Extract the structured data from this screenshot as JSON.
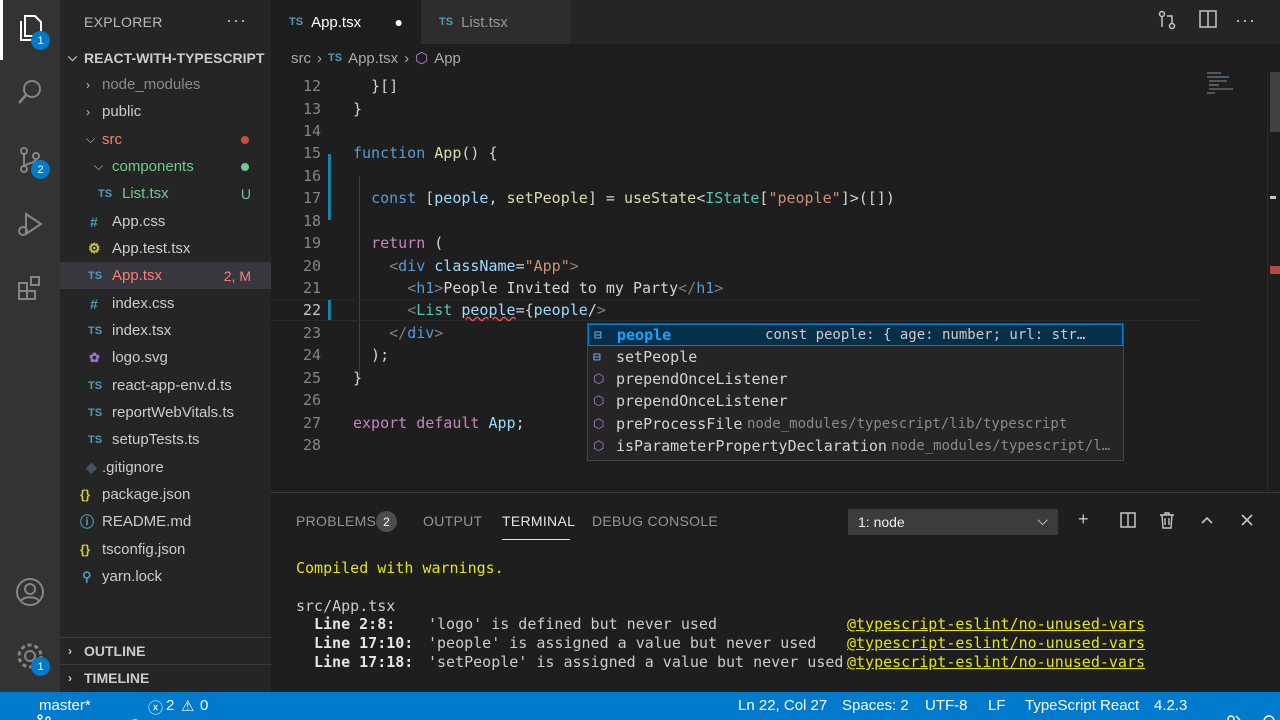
{
  "activity_bar": {
    "explorer_badge": "1",
    "scm_badge": "2",
    "settings_badge": "1"
  },
  "sidebar": {
    "title": "EXPLORER",
    "more": "···",
    "project": "REACT-WITH-TYPESCRIPT",
    "items": [
      {
        "label": "node_modules",
        "kind": "folder"
      },
      {
        "label": "public",
        "kind": "folder"
      },
      {
        "label": "src",
        "kind": "folder"
      },
      {
        "label": "components",
        "kind": "folder"
      },
      {
        "label": "List.tsx",
        "kind": "ts",
        "deco": "U"
      },
      {
        "label": "App.css",
        "kind": "css"
      },
      {
        "label": "App.test.tsx",
        "kind": "test"
      },
      {
        "label": "App.tsx",
        "kind": "ts",
        "deco": "2, M"
      },
      {
        "label": "index.css",
        "kind": "css"
      },
      {
        "label": "index.tsx",
        "kind": "ts"
      },
      {
        "label": "logo.svg",
        "kind": "svg"
      },
      {
        "label": "react-app-env.d.ts",
        "kind": "ts"
      },
      {
        "label": "reportWebVitals.ts",
        "kind": "ts"
      },
      {
        "label": "setupTests.ts",
        "kind": "ts"
      },
      {
        "label": ".gitignore",
        "kind": "git"
      },
      {
        "label": "package.json",
        "kind": "json"
      },
      {
        "label": "README.md",
        "kind": "info"
      },
      {
        "label": "tsconfig.json",
        "kind": "json"
      },
      {
        "label": "yarn.lock",
        "kind": "lock"
      }
    ],
    "outline": "OUTLINE",
    "timeline": "TIMELINE"
  },
  "tabs": [
    {
      "icon": "TS",
      "label": "App.tsx",
      "dirty": "●"
    },
    {
      "icon": "TS",
      "label": "List.tsx"
    }
  ],
  "breadcrumb": {
    "folder": "src",
    "file_icon": "TS",
    "file": "App.tsx",
    "symbol": "App"
  },
  "editor": {
    "line_numbers": [
      "12",
      "13",
      "14",
      "15",
      "16",
      "17",
      "18",
      "19",
      "20",
      "21",
      "22",
      "23",
      "24",
      "25",
      "26",
      "27",
      "28"
    ]
  },
  "suggest": {
    "items": [
      {
        "label": "people",
        "detail": "const people: { age: number; url: str…"
      },
      {
        "label": "setPeople",
        "detail": ""
      },
      {
        "label": "prependOnceListener",
        "detail": ""
      },
      {
        "label": "prependOnceListener",
        "detail": ""
      },
      {
        "label": "preProcessFile",
        "detail": "node_modules/typescript/lib/typescript"
      },
      {
        "label": "isParameterPropertyDeclaration",
        "detail": "node_modules/typescript/l…"
      }
    ]
  },
  "panel": {
    "tabs": {
      "problems": "PROBLEMS",
      "problems_count": "2",
      "output": "OUTPUT",
      "terminal": "TERMINAL",
      "debug": "DEBUG CONSOLE"
    },
    "terminal_select": "1: node",
    "terminal": {
      "compiled": "Compiled with warnings.",
      "file": "src/App.tsx",
      "warnings": [
        {
          "loc": "Line 2:8:",
          "msg": "'logo' is defined but never used",
          "rule": "@typescript-eslint/no-unused-vars"
        },
        {
          "loc": "Line 17:10:",
          "msg": "'people' is assigned a value but never used",
          "rule": "@typescript-eslint/no-unused-vars"
        },
        {
          "loc": "Line 17:18:",
          "msg": "'setPeople' is assigned a value but never used",
          "rule": "@typescript-eslint/no-unused-vars"
        }
      ]
    }
  },
  "status": {
    "branch": "master*",
    "errors": "2",
    "warnings": "0",
    "position": "Ln 22, Col 27",
    "spaces": "Spaces: 2",
    "encoding": "UTF-8",
    "eol": "LF",
    "language": "TypeScript React",
    "ts_version": "4.2.3"
  },
  "colors": {
    "accent": "#007acc",
    "status_bar": "#007acc",
    "modified": "#e2c08d",
    "untracked": "#73c991",
    "error_folder": "#f88070"
  }
}
